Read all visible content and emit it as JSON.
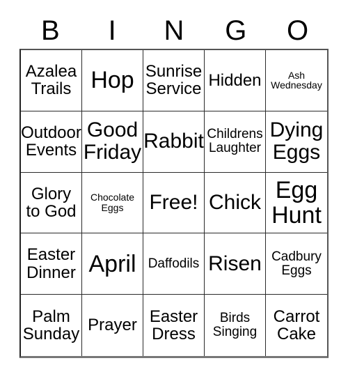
{
  "header": {
    "letters": [
      "B",
      "I",
      "N",
      "G",
      "O"
    ]
  },
  "grid": {
    "rows": 5,
    "columns": 5,
    "cells": [
      {
        "text": "Azalea\nTrails",
        "size": "sz-md"
      },
      {
        "text": "Hop",
        "size": "sz-xl"
      },
      {
        "text": "Sunrise\nService",
        "size": "sz-md"
      },
      {
        "text": "Hidden",
        "size": "sz-md"
      },
      {
        "text": "Ash\nWednesday",
        "size": "sz-xs"
      },
      {
        "text": "Outdoor\nEvents",
        "size": "sz-md"
      },
      {
        "text": "Good\nFriday",
        "size": "sz-lg"
      },
      {
        "text": "Rabbit",
        "size": "sz-lg"
      },
      {
        "text": "Childrens\nLaughter",
        "size": "sz-sm"
      },
      {
        "text": "Dying\nEggs",
        "size": "sz-lg"
      },
      {
        "text": "Glory\nto God",
        "size": "sz-md"
      },
      {
        "text": "Chocolate\nEggs",
        "size": "sz-xs"
      },
      {
        "text": "Free!",
        "size": "sz-lg"
      },
      {
        "text": "Chick",
        "size": "sz-lg"
      },
      {
        "text": "Egg\nHunt",
        "size": "sz-xl"
      },
      {
        "text": "Easter\nDinner",
        "size": "sz-md"
      },
      {
        "text": "April",
        "size": "sz-xl"
      },
      {
        "text": "Daffodils",
        "size": "sz-sm"
      },
      {
        "text": "Risen",
        "size": "sz-lg"
      },
      {
        "text": "Cadbury\nEggs",
        "size": "sz-sm"
      },
      {
        "text": "Palm\nSunday",
        "size": "sz-md"
      },
      {
        "text": "Prayer",
        "size": "sz-md"
      },
      {
        "text": "Easter\nDress",
        "size": "sz-md"
      },
      {
        "text": "Birds\nSinging",
        "size": "sz-sm"
      },
      {
        "text": "Carrot\nCake",
        "size": "sz-md"
      }
    ]
  },
  "colors": {
    "background": "#ffffff",
    "text": "#000000",
    "grid_line": "#2a2a2a"
  }
}
